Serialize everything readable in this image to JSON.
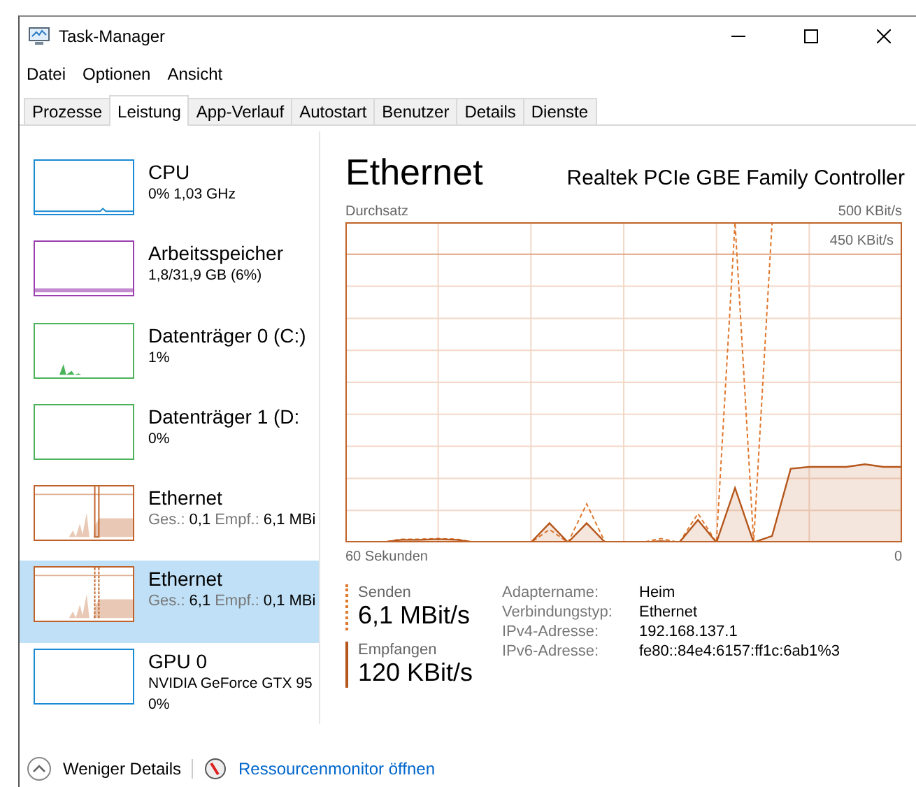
{
  "window": {
    "title": "Task-Manager"
  },
  "menu": [
    "Datei",
    "Optionen",
    "Ansicht"
  ],
  "tabs": [
    {
      "label": "Prozesse",
      "selected": false
    },
    {
      "label": "Leistung",
      "selected": true
    },
    {
      "label": "App-Verlauf",
      "selected": false
    },
    {
      "label": "Autostart",
      "selected": false
    },
    {
      "label": "Benutzer",
      "selected": false
    },
    {
      "label": "Details",
      "selected": false
    },
    {
      "label": "Dienste",
      "selected": false
    }
  ],
  "sidebar": {
    "items": [
      {
        "kind": "cpu",
        "name": "CPU",
        "details": [
          "0% 1,03 GHz"
        ],
        "color": "#1a8ad4",
        "selected": false
      },
      {
        "kind": "memory",
        "name": "Arbeitsspeicher",
        "details": [
          "1,8/31,9 GB (6%)"
        ],
        "color": "#9b3fb0",
        "selected": false
      },
      {
        "kind": "disk",
        "name": "Datenträger 0 (C:)",
        "details": [
          "1%"
        ],
        "color": "#4cb35a",
        "selected": false
      },
      {
        "kind": "disk",
        "name": "Datenträger 1 (D:",
        "details": [
          "0%"
        ],
        "color": "#4cb35a",
        "selected": false
      },
      {
        "kind": "ethernet",
        "name": "Ethernet",
        "stats": [
          {
            "label": "Ges.:",
            "value": "0,1"
          },
          {
            "label": "Empf.:",
            "value": "6,1 MBi"
          }
        ],
        "color": "#c0632a",
        "selected": false
      },
      {
        "kind": "ethernet",
        "name": "Ethernet",
        "stats": [
          {
            "label": "Ges.:",
            "value": "6,1"
          },
          {
            "label": "Empf.:",
            "value": "0,1 MBi"
          }
        ],
        "color": "#c0632a",
        "selected": true
      },
      {
        "kind": "gpu",
        "name": "GPU 0",
        "details": [
          "NVIDIA GeForce GTX 95",
          "0%"
        ],
        "color": "#1a8ad4",
        "selected": false
      }
    ]
  },
  "detail": {
    "title": "Ethernet",
    "adapter": "Realtek PCIe GBE Family Controller",
    "graph": {
      "label": "Durchsatz",
      "max": "500 KBit/s",
      "scale": "450 KBit/s",
      "time_start": "60 Sekunden",
      "time_end": "0"
    },
    "rates": [
      {
        "kind": "send",
        "label": "Senden",
        "value": "6,1 MBit/s"
      },
      {
        "kind": "receive",
        "label": "Empfangen",
        "value": "120 KBit/s"
      }
    ],
    "info": [
      {
        "label": "Adaptername:",
        "value": "Heim"
      },
      {
        "label": "Verbindungstyp:",
        "value": "Ethernet"
      },
      {
        "label": "IPv4-Adresse:",
        "value": "192.168.137.1"
      },
      {
        "label": "IPv6-Adresse:",
        "value": "fe80::84e4:6157:ff1c:6ab1%3"
      }
    ]
  },
  "footer": {
    "less_details": "Weniger Details",
    "resource_monitor": "Ressourcenmonitor öffnen"
  }
}
